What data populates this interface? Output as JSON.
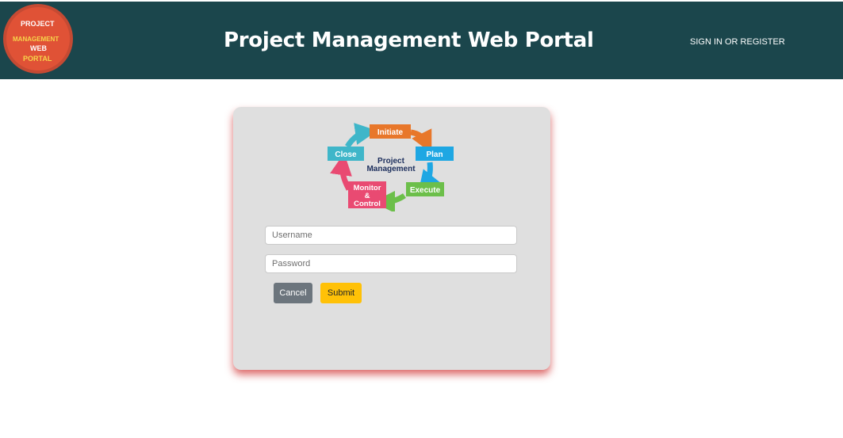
{
  "header": {
    "logo": {
      "line1": "PROJECT",
      "line2": "MANAGEMENT",
      "line3": "WEB",
      "line4": "PORTAL"
    },
    "title": "Project Management Web Portal",
    "signin_link": "SIGN IN OR REGISTER"
  },
  "cycle_graphic": {
    "center_line1": "Project",
    "center_line2": "Management",
    "stages": {
      "initiate": "Initiate",
      "plan": "Plan",
      "execute": "Execute",
      "monitor_line1": "Monitor",
      "monitor_line2": "&",
      "monitor_line3": "Control",
      "close": "Close"
    }
  },
  "login_form": {
    "username_placeholder": "Username",
    "username_value": "",
    "password_placeholder": "Password",
    "password_value": "",
    "cancel_label": "Cancel",
    "submit_label": "Submit"
  },
  "colors": {
    "header_bg": "#1b464c",
    "logo_red": "#e05236",
    "logo_yellow": "#f7d54a",
    "card_bg": "#dfdfdf",
    "initiate": "#e8772a",
    "plan": "#1ea7e3",
    "execute": "#6cbf4a",
    "monitor": "#e94a72",
    "close": "#3fb6c9",
    "cancel_button": "#6c757d",
    "submit_button": "#ffc107"
  },
  "icons": {
    "logo": "pmwp-logo-circle",
    "cycle": "project-lifecycle-cycle"
  }
}
